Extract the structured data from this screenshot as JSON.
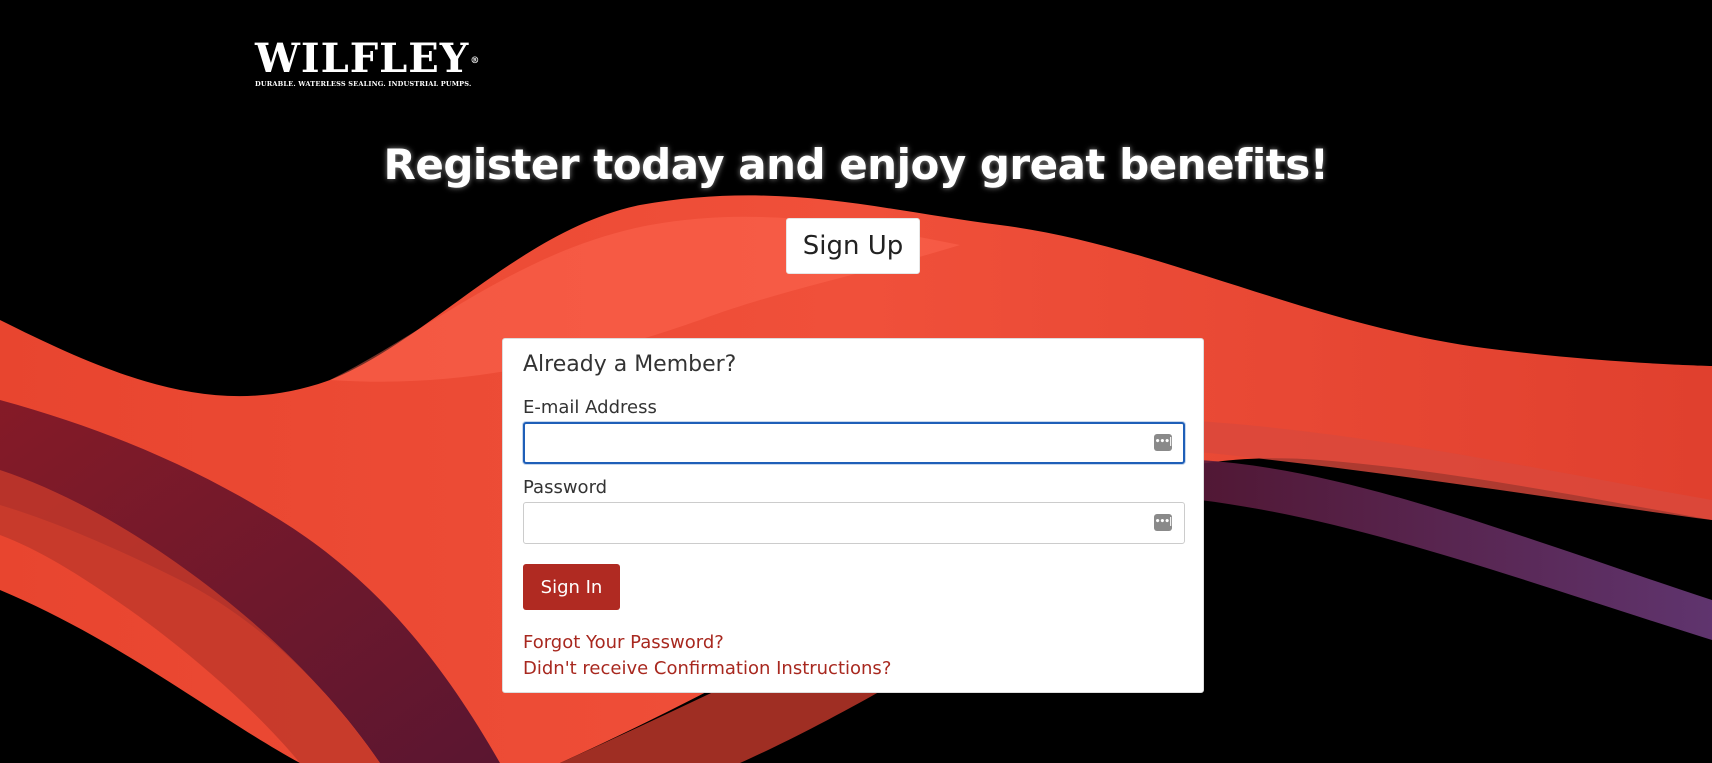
{
  "brand": {
    "logo_text": "WILFLEY",
    "registered_mark": "®",
    "tagline": "DURABLE. WATERLESS SEALING. INDUSTRIAL PUMPS."
  },
  "hero": {
    "headline": "Register today and enjoy great benefits!",
    "signup_label": "Sign Up"
  },
  "login": {
    "title": "Already a Member?",
    "email_label": "E-mail Address",
    "email_value": "",
    "password_label": "Password",
    "password_value": "",
    "signin_label": "Sign In",
    "forgot_password_link": "Forgot Your Password?",
    "confirmation_link": "Didn't receive Confirmation Instructions?"
  },
  "colors": {
    "background": "#000000",
    "accent_red": "#b02a22",
    "link_red": "#a8281f",
    "focus_blue": "#1f5fb8"
  },
  "icons": {
    "field_icon": "autofill-key-icon"
  }
}
